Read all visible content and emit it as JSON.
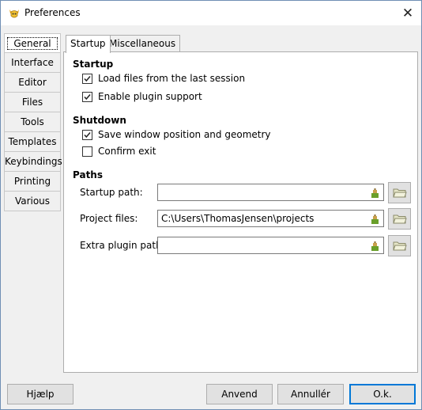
{
  "window": {
    "title": "Preferences"
  },
  "sidebar": {
    "items": [
      {
        "label": "General"
      },
      {
        "label": "Interface"
      },
      {
        "label": "Editor"
      },
      {
        "label": "Files"
      },
      {
        "label": "Tools"
      },
      {
        "label": "Templates"
      },
      {
        "label": "Keybindings"
      },
      {
        "label": "Printing"
      },
      {
        "label": "Various"
      }
    ],
    "selected": "General"
  },
  "tabs": [
    {
      "label": "Startup"
    },
    {
      "label": "Miscellaneous"
    }
  ],
  "startup": {
    "heading": "Startup",
    "load_files": {
      "label": "Load files from the last session",
      "checked": true
    },
    "plugin_support": {
      "label": "Enable plugin support",
      "checked": true
    }
  },
  "shutdown": {
    "heading": "Shutdown",
    "save_window": {
      "label": "Save window position and geometry",
      "checked": true
    },
    "confirm_exit": {
      "label": "Confirm exit",
      "checked": false
    }
  },
  "paths": {
    "heading": "Paths",
    "startup_path": {
      "label": "Startup path:",
      "value": ""
    },
    "project_files": {
      "label": "Project files:",
      "value": "C:\\Users\\ThomasJensen\\projects"
    },
    "extra_plugin": {
      "label": "Extra plugin path:",
      "value": ""
    }
  },
  "buttons": {
    "help": "Hjælp",
    "apply": "Anvend",
    "cancel": "Annullér",
    "ok": "O.k."
  },
  "colors": {
    "accent": "#0078d7",
    "panel_bg": "#ffffff",
    "window_bg": "#f0f0f0"
  }
}
